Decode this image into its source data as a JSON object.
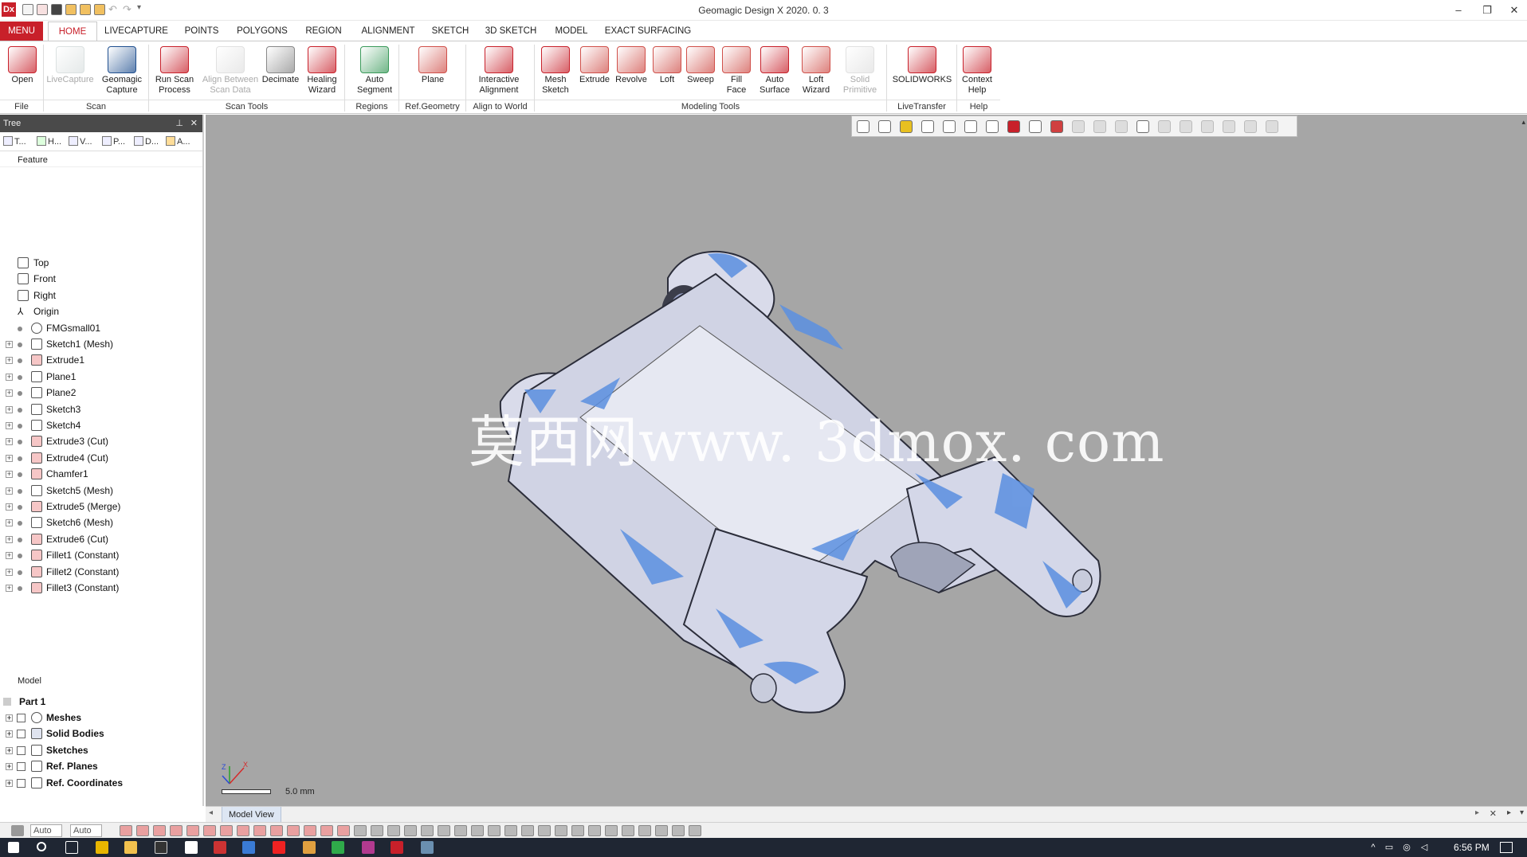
{
  "window": {
    "title": "Geomagic Design X 2020. 0. 3",
    "logo": "Dx"
  },
  "ribbon_tabs": [
    "MENU",
    "HOME",
    "LIVECAPTURE",
    "POINTS",
    "POLYGONS",
    "REGION",
    "ALIGNMENT",
    "SKETCH",
    "3D SKETCH",
    "MODEL",
    "EXACT SURFACING"
  ],
  "ribbon": {
    "buttons": [
      {
        "l1": "Open",
        "l2": "",
        "enabled": true,
        "color": "#c8202a"
      },
      {
        "l1": "LiveCapture",
        "l2": "",
        "enabled": false,
        "color": "#9aa"
      },
      {
        "l1": "Geomagic",
        "l2": "Capture",
        "enabled": true,
        "color": "#1f4f8f"
      },
      {
        "l1": "Run Scan",
        "l2": "Process",
        "enabled": true,
        "color": "#c8202a"
      },
      {
        "l1": "Align Between",
        "l2": "Scan Data",
        "enabled": false,
        "color": "#aaa"
      },
      {
        "l1": "Decimate",
        "l2": "",
        "enabled": true,
        "color": "#888"
      },
      {
        "l1": "Healing",
        "l2": "Wizard",
        "enabled": true,
        "color": "#c8202a"
      },
      {
        "l1": "Auto",
        "l2": "Segment",
        "enabled": true,
        "color": "#3a9a5a"
      },
      {
        "l1": "Plane",
        "l2": "",
        "enabled": true,
        "color": "#d0504a"
      },
      {
        "l1": "Interactive",
        "l2": "Alignment",
        "enabled": true,
        "color": "#c8202a"
      },
      {
        "l1": "Mesh",
        "l2": "Sketch",
        "enabled": true,
        "color": "#c8202a"
      },
      {
        "l1": "Extrude",
        "l2": "",
        "enabled": true,
        "color": "#d0504a"
      },
      {
        "l1": "Revolve",
        "l2": "",
        "enabled": true,
        "color": "#d0504a"
      },
      {
        "l1": "Loft",
        "l2": "",
        "enabled": true,
        "color": "#d0504a"
      },
      {
        "l1": "Sweep",
        "l2": "",
        "enabled": true,
        "color": "#d0504a"
      },
      {
        "l1": "Fill",
        "l2": "Face",
        "enabled": true,
        "color": "#d0504a"
      },
      {
        "l1": "Auto",
        "l2": "Surface",
        "enabled": true,
        "color": "#c8202a"
      },
      {
        "l1": "Loft",
        "l2": "Wizard",
        "enabled": true,
        "color": "#d0504a"
      },
      {
        "l1": "Solid",
        "l2": "Primitive",
        "enabled": false,
        "color": "#aaa"
      },
      {
        "l1": "SOLIDWORKS",
        "l2": "",
        "enabled": true,
        "color": "#c8202a"
      },
      {
        "l1": "Context",
        "l2": "Help",
        "enabled": true,
        "color": "#c8202a"
      }
    ],
    "groups": [
      "File",
      "Scan",
      "Scan Tools",
      "Regions",
      "Ref.Geometry",
      "Align to World",
      "Modeling Tools",
      "LiveTransfer",
      "Help"
    ]
  },
  "tree": {
    "title": "Tree",
    "tabs": [
      "T...",
      "H...",
      "V...",
      "P...",
      "D...",
      "A..."
    ],
    "feature_header": "Feature",
    "features": [
      "Top",
      "Front",
      "Right",
      "Origin",
      "FMGsmall01",
      "Sketch1 (Mesh)",
      "Extrude1",
      "Plane1",
      "Plane2",
      "Sketch3",
      "Sketch4",
      "Extrude3 (Cut)",
      "Extrude4 (Cut)",
      "Chamfer1",
      "Sketch5 (Mesh)",
      "Extrude5 (Merge)",
      "Sketch6 (Mesh)",
      "Extrude6 (Cut)",
      "Fillet1 (Constant)",
      "Fillet2 (Constant)",
      "Fillet3 (Constant)"
    ],
    "model_header": "Model",
    "part": "Part 1",
    "model_items": [
      "Meshes",
      "Solid Bodies",
      "Sketches",
      "Ref. Planes",
      "Ref. Coordinates"
    ]
  },
  "viewport": {
    "watermark": "莫西网www. 3dmox. com",
    "scale_label": "5.0 mm",
    "background": "#a6a6a6",
    "body_color": "#d9dbea",
    "deviation_color": "#5b8fe0"
  },
  "bottom_tab": "Model View",
  "status": {
    "select1": "Auto",
    "select2": "Auto"
  },
  "taskbar": {
    "clock": "6:56 PM"
  }
}
